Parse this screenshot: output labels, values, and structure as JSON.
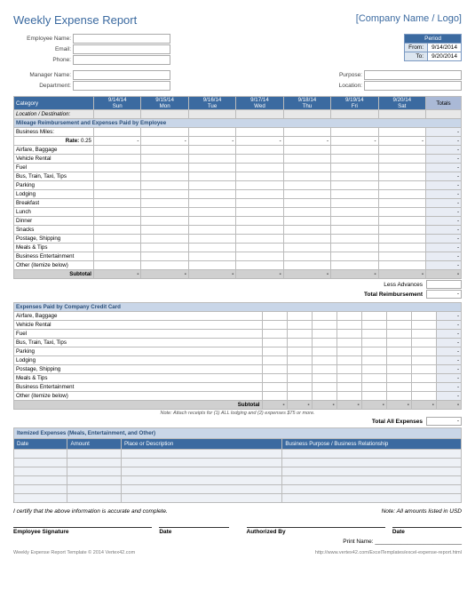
{
  "title": "Weekly Expense Report",
  "company": "[Company Name / Logo]",
  "fields": {
    "employee_name": "Employee Name:",
    "email": "Email:",
    "phone": "Phone:",
    "manager_name": "Manager Name:",
    "department": "Department:",
    "purpose": "Purpose:",
    "location": "Location:"
  },
  "period": {
    "header": "Period",
    "from_lbl": "From:",
    "from": "9/14/2014",
    "to_lbl": "To:",
    "to": "9/20/2014"
  },
  "cols": {
    "category": "Category",
    "days": [
      {
        "d": "9/14/14",
        "w": "Sun"
      },
      {
        "d": "9/15/14",
        "w": "Mon"
      },
      {
        "d": "9/16/14",
        "w": "Tue"
      },
      {
        "d": "9/17/14",
        "w": "Wed"
      },
      {
        "d": "9/18/14",
        "w": "Thu"
      },
      {
        "d": "9/19/14",
        "w": "Fri"
      },
      {
        "d": "9/20/14",
        "w": "Sat"
      }
    ],
    "totals": "Totals"
  },
  "loc_dest": "Location / Destination:",
  "sec1": "Mileage Reimbursement and Expenses Paid by Employee",
  "biz_miles": "Business Miles:",
  "rate_lbl": "Rate:",
  "rate_val": "0.25",
  "rows1": [
    "Airfare, Baggage",
    "Vehicle Rental",
    "Fuel",
    "Bus, Train, Taxi, Tips",
    "Parking",
    "Lodging",
    "Breakfast",
    "Lunch",
    "Dinner",
    "Snacks",
    "Postage, Shipping",
    "Meals & Tips",
    "Business Entertainment",
    "Other (itemize below)"
  ],
  "subtotal": "Subtotal",
  "less_adv": "Less Advances",
  "tot_reimb": "Total Reimbursement",
  "sec2": "Expenses Paid by Company Credit Card",
  "rows2": [
    "Airfare, Baggage",
    "Vehicle Rental",
    "Fuel",
    "Bus, Train, Taxi, Tips",
    "Parking",
    "Lodging",
    "Postage, Shipping",
    "Meals & Tips",
    "Business Entertainment",
    "Other (itemize below)"
  ],
  "receipt_note": "Note: Attach receipts for (1) ALL lodging and (2) expenses $75 or more.",
  "tot_all": "Total All Expenses",
  "sec3": "Itemized Expenses (Meals, Entertainment, and Other)",
  "item_cols": [
    "Date",
    "Amount",
    "Place or Description",
    "Business Purpose / Business Relationship"
  ],
  "cert": "I certify that the above information is accurate and complete.",
  "usd_note": "Note: All amounts listed in USD",
  "sig": {
    "emp": "Employee Signature",
    "date": "Date",
    "auth": "Authorized By",
    "print": "Print Name:"
  },
  "foot": {
    "left": "Weekly Expense Report Template © 2014 Vertex42.com",
    "right": "http://www.vertex42.com/ExcelTemplates/excel-expense-report.html"
  }
}
